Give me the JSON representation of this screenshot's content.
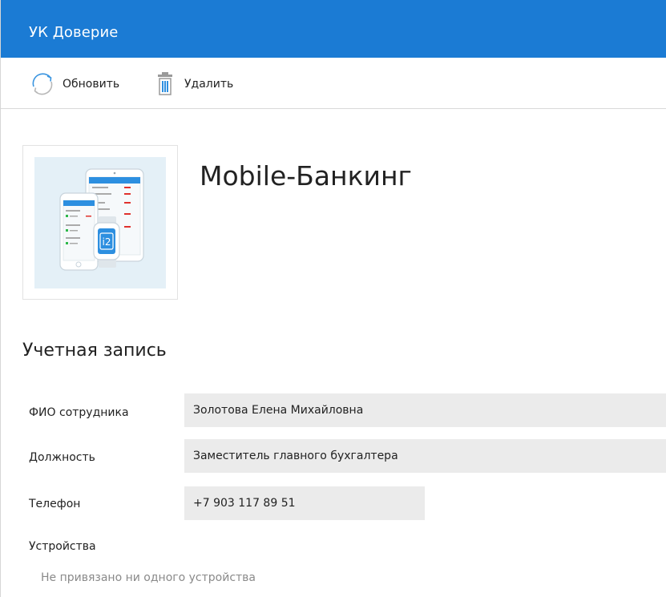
{
  "window": {
    "title": "УК Доверие"
  },
  "toolbar": {
    "refresh_label": "Обновить",
    "delete_label": "Удалить"
  },
  "app": {
    "name": "Mobile-Банкинг",
    "logo_badge": "i2"
  },
  "account": {
    "heading": "Учетная запись",
    "fields": [
      {
        "label": "ФИО сотрудника",
        "value": "Золотова Елена Михайловна"
      },
      {
        "label": "Должность",
        "value": "Заместитель главного бухгалтера"
      },
      {
        "label": "Телефон",
        "value": "+7 903 117 89 51"
      }
    ],
    "devices_label": "Устройства",
    "devices_empty": "Не привязано ни одного устройства"
  },
  "colors": {
    "header_bg": "#1b7bd4",
    "field_bg": "#ebebeb",
    "icon_blue": "#2d8fe0",
    "icon_gray": "#8c8c8c"
  },
  "icons": [
    "refresh-icon",
    "trash-icon",
    "mobile-banking-logo"
  ]
}
